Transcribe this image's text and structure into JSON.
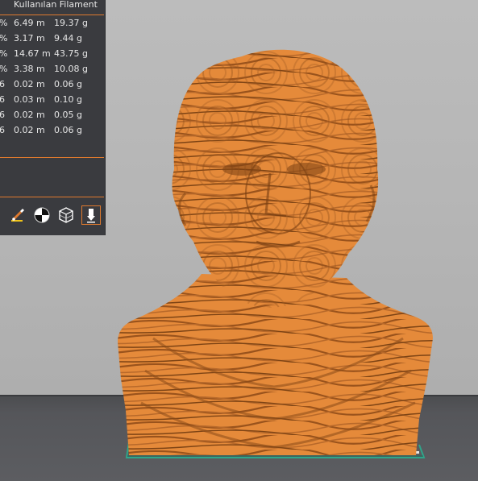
{
  "panel": {
    "header": "Kullanılan Filament",
    "rows": [
      {
        "pct": "%",
        "length": "6.49 m",
        "weight": "19.37 g"
      },
      {
        "pct": "%",
        "length": "3.17 m",
        "weight": "9.44 g"
      },
      {
        "pct": "%",
        "length": "14.67 m",
        "weight": "43.75 g"
      },
      {
        "pct": "%",
        "length": "3.38 m",
        "weight": "10.08 g"
      },
      {
        "pct": "6",
        "length": "0.02 m",
        "weight": "0.06 g"
      },
      {
        "pct": "6",
        "length": "0.03 m",
        "weight": "0.10 g"
      },
      {
        "pct": "6",
        "length": "0.02 m",
        "weight": "0.05 g"
      },
      {
        "pct": "6",
        "length": "0.02 m",
        "weight": "0.06 g"
      }
    ],
    "tools": [
      {
        "icon": "paint-brush-icon"
      },
      {
        "icon": "color-wheel-icon"
      },
      {
        "icon": "wireframe-cube-icon"
      },
      {
        "icon": "extruder-icon",
        "active": true
      }
    ]
  },
  "colors": {
    "accent": "#e07a2e",
    "model_orange": "#e58a3a",
    "model_dark": "#8a4a17",
    "panel_bg": "#3a3b3f",
    "bed_outline": "#2fa58a"
  }
}
